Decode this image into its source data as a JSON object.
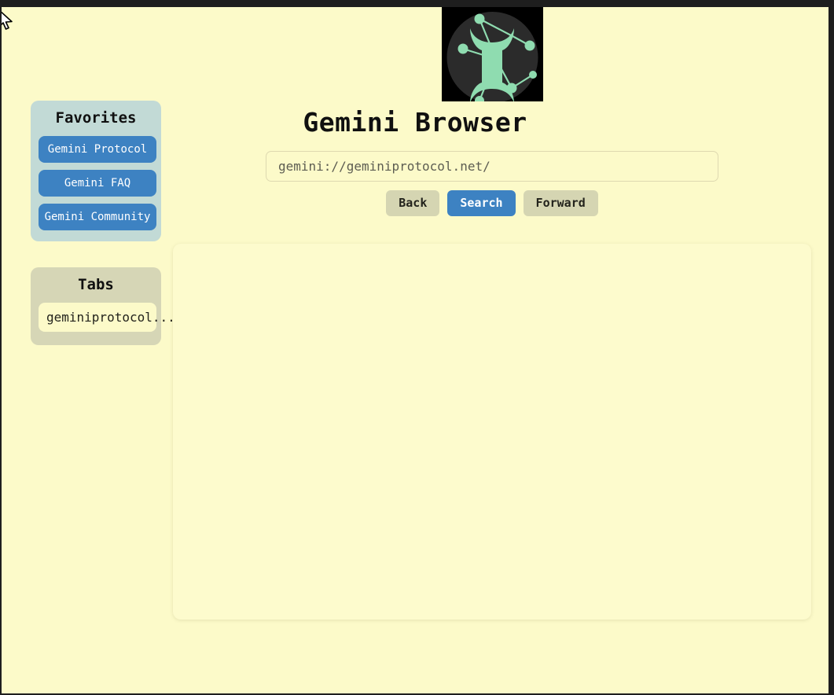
{
  "window": {
    "titlebar_color": "#1e1e1e",
    "background_color": "#fcfac9"
  },
  "header": {
    "title": "Gemini Browser",
    "logo_icon": "gemini-constellation-logo",
    "logo_symbol_color": "#8fdcb0",
    "logo_circle_color": "#2b2b2b"
  },
  "address_bar": {
    "value": "gemini://geminiprotocol.net/",
    "placeholder": "gemini://geminiprotocol.net/"
  },
  "nav": {
    "back_label": "Back",
    "search_label": "Search",
    "forward_label": "Forward",
    "primary_color": "#3d82c2",
    "secondary_color": "#d5d5b2"
  },
  "sidebar": {
    "favorites": {
      "title": "Favorites",
      "panel_color": "#c2dad6",
      "items": [
        {
          "label": "Gemini Protocol"
        },
        {
          "label": "Gemini FAQ"
        },
        {
          "label": "Gemini Community"
        }
      ]
    },
    "tabs": {
      "title": "Tabs",
      "panel_color": "#d6d6b6",
      "items": [
        {
          "label": "geminiprotocol..."
        }
      ]
    }
  },
  "content": {
    "body_text": "",
    "background_color": "#fdfbcd"
  },
  "cursor": {
    "icon": "arrow-pointer"
  }
}
